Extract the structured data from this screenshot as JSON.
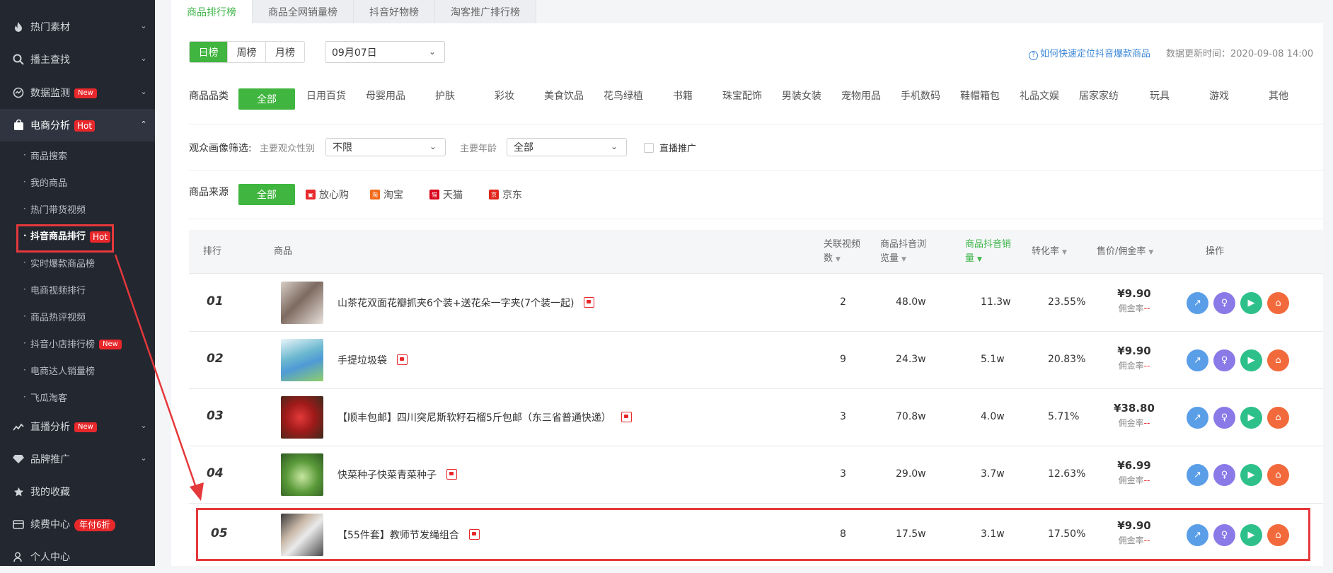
{
  "sidebar": {
    "items": [
      {
        "label": "热门素材",
        "icon": "flame-icon"
      },
      {
        "label": "播主查找",
        "icon": "search-icon"
      },
      {
        "label": "数据监测",
        "icon": "monitor-icon",
        "badge": "New"
      },
      {
        "label": "电商分析",
        "icon": "shopping-bag-icon",
        "badge": "Hot"
      },
      {
        "label": "直播分析",
        "icon": "live-chart-icon",
        "badge": "New"
      },
      {
        "label": "品牌推广",
        "icon": "diamond-icon"
      },
      {
        "label": "我的收藏",
        "icon": "star-icon"
      },
      {
        "label": "续费中心",
        "icon": "card-icon",
        "badge": "年付6折"
      },
      {
        "label": "个人中心",
        "icon": "user-icon"
      }
    ],
    "sub_items": [
      {
        "label": "商品搜索"
      },
      {
        "label": "我的商品"
      },
      {
        "label": "热门带货视频"
      },
      {
        "label": "抖音商品排行",
        "badge": "Hot"
      },
      {
        "label": "实时爆款商品榜"
      },
      {
        "label": "电商视频排行"
      },
      {
        "label": "商品热评视频"
      },
      {
        "label": "抖音小店排行榜",
        "badge": "New"
      },
      {
        "label": "电商达人销量榜"
      },
      {
        "label": "飞瓜淘客"
      }
    ]
  },
  "tabs": [
    "商品排行榜",
    "商品全网销量榜",
    "抖音好物榜",
    "淘客推广排行榜"
  ],
  "period": {
    "options": [
      "日榜",
      "周榜",
      "月榜"
    ],
    "date": "09月07日"
  },
  "help_link": "如何快速定位抖音爆款商品",
  "update_time": "数据更新时间：2020-09-08 14:00",
  "category": {
    "label": "商品品类",
    "items": [
      "全部",
      "日用百货",
      "母婴用品",
      "护肤",
      "彩妆",
      "美食饮品",
      "花鸟绿植",
      "书籍",
      "珠宝配饰",
      "男装女装",
      "宠物用品",
      "手机数码",
      "鞋帽箱包",
      "礼品文娱",
      "居家家纺",
      "玩具",
      "游戏",
      "其他"
    ]
  },
  "audience": {
    "label": "观众画像筛选:",
    "gender_label": "主要观众性别",
    "gender_value": "不限",
    "age_label": "主要年龄",
    "age_value": "全部",
    "live_label": "直播推广"
  },
  "source": {
    "label": "商品来源",
    "items": [
      {
        "label": "全部"
      },
      {
        "label": "放心购",
        "color": "#e8282b"
      },
      {
        "label": "淘宝",
        "color": "#f26a1b"
      },
      {
        "label": "天猫",
        "color": "#d9001b"
      },
      {
        "label": "京东",
        "color": "#e1251b"
      }
    ]
  },
  "table": {
    "headers": {
      "rank": "排行",
      "product": "商品",
      "videos": "关联视频数",
      "views": "商品抖音浏览量",
      "sales": "商品抖音销量",
      "conversion": "转化率",
      "price": "售价/佣金率",
      "ops": "操作"
    },
    "commission_label": "佣金率",
    "commission_value": "--",
    "rows": [
      {
        "rank": "01",
        "name": "山茶花双面花瓣抓夹6个装+送花朵一字夹(7个装一起)",
        "videos": "2",
        "views": "48.0w",
        "sales": "11.3w",
        "conversion": "23.55%",
        "price": "¥9.90"
      },
      {
        "rank": "02",
        "name": "手提垃圾袋",
        "videos": "9",
        "views": "24.3w",
        "sales": "5.1w",
        "conversion": "20.83%",
        "price": "¥9.90"
      },
      {
        "rank": "03",
        "name": "【顺丰包邮】四川突尼斯软籽石榴5斤包邮（东三省普通快递）",
        "videos": "3",
        "views": "70.8w",
        "sales": "4.0w",
        "conversion": "5.71%",
        "price": "¥38.80"
      },
      {
        "rank": "04",
        "name": "快菜种子快菜青菜种子",
        "videos": "3",
        "views": "29.0w",
        "sales": "3.7w",
        "conversion": "12.63%",
        "price": "¥6.99"
      },
      {
        "rank": "05",
        "name": "【55件套】教师节发绳组合",
        "videos": "8",
        "views": "17.5w",
        "sales": "3.1w",
        "conversion": "17.50%",
        "price": "¥9.90"
      }
    ]
  },
  "colors": {
    "accent": "#40b53f",
    "badge": "#e8282b",
    "highlight": "#e5383b",
    "sidebar": "#232730"
  }
}
